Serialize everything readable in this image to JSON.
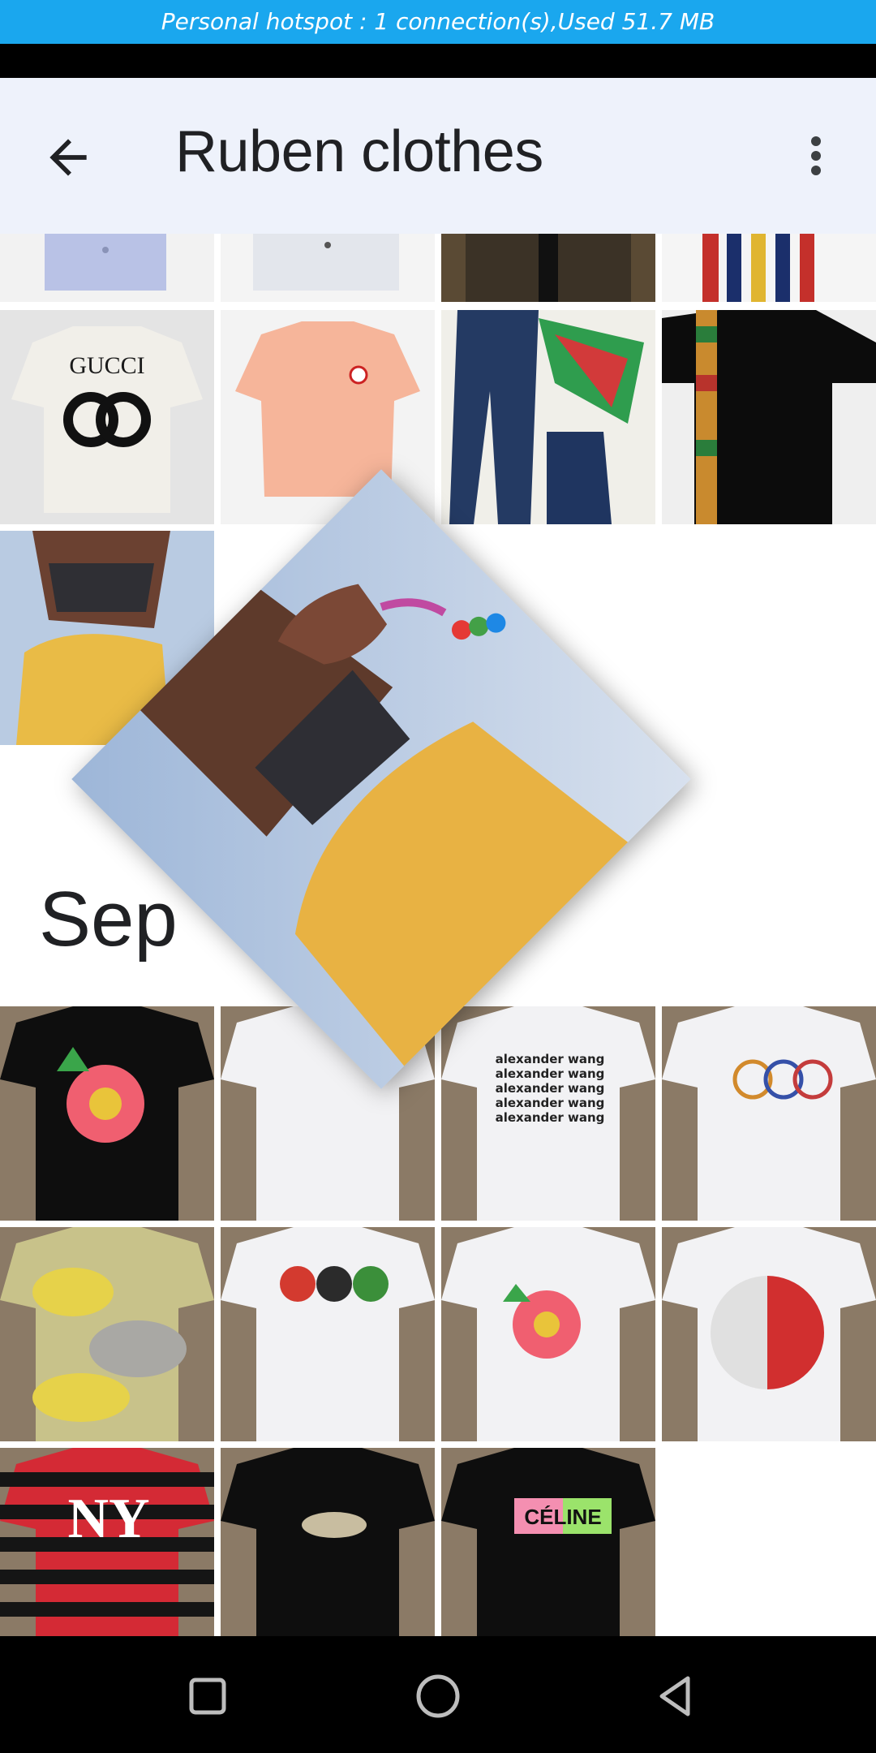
{
  "status": {
    "hotspot_text": "Personal hotspot : 1 connection(s),Used   51.7 MB"
  },
  "app_bar": {
    "title": "Ruben clothes",
    "back_icon": "arrow-back-icon",
    "menu_icon": "more-vert-icon"
  },
  "section": {
    "heading": "Sep"
  },
  "thumb_text": {
    "gucci": "GUCCI",
    "alexander": [
      "alexander wang",
      "alexander wang",
      "alexander wang",
      "alexander wang",
      "alexander wang"
    ],
    "celine": "CÉLINE",
    "ny": "NY"
  },
  "nav": {
    "square": "recents-square-icon",
    "circle": "home-circle-icon",
    "triangle": "back-triangle-icon"
  }
}
